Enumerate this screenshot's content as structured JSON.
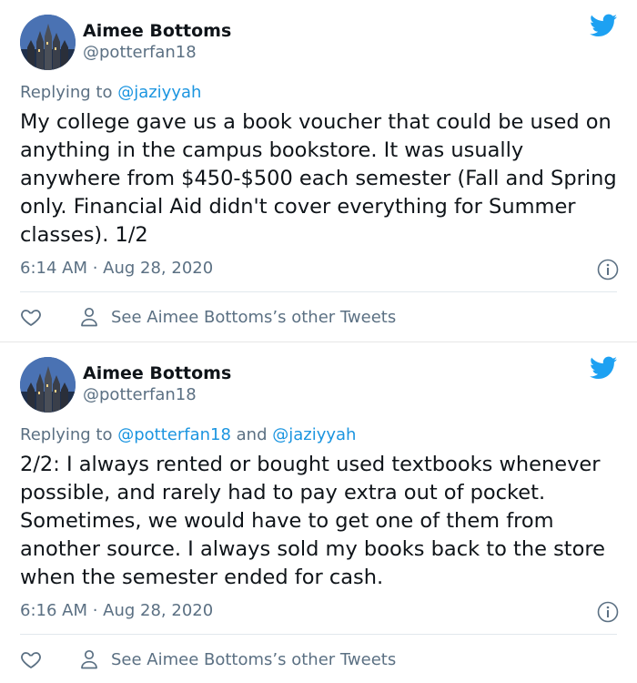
{
  "tweets": [
    {
      "name": "Aimee Bottoms",
      "handle": "@potterfan18",
      "replying_prefix": "Replying to ",
      "mentions": [
        "@jaziyyah"
      ],
      "mention_joiner": "",
      "text": "My college gave us a book voucher that could be used on anything in the campus bookstore. It was usually anywhere from $450-$500 each semester (Fall and Spring only. Financial Aid didn't cover everything for Summer classes). 1/2",
      "timestamp": "6:14 AM · Aug 28, 2020",
      "other_tweets_label": "See Aimee Bottoms’s other Tweets"
    },
    {
      "name": "Aimee Bottoms",
      "handle": "@potterfan18",
      "replying_prefix": "Replying to ",
      "mentions": [
        "@potterfan18",
        "@jaziyyah"
      ],
      "mention_joiner": " and ",
      "text": "2/2: I always rented or bought used textbooks whenever possible, and rarely had to pay extra out of pocket. Sometimes, we would have to get one of them from another source. I always sold my books back to the store when the semester ended for cash.",
      "timestamp": "6:16 AM · Aug 28, 2020",
      "other_tweets_label": "See Aimee Bottoms’s other Tweets"
    }
  ],
  "colors": {
    "brand": "#1da1f2",
    "mention": "#1b95e0",
    "secondary_text": "#5b7083",
    "divider": "#e1e8ed"
  },
  "icons": {
    "brand": "twitter-bird-icon",
    "info": "info-icon",
    "like": "heart-icon",
    "profile": "person-icon"
  }
}
